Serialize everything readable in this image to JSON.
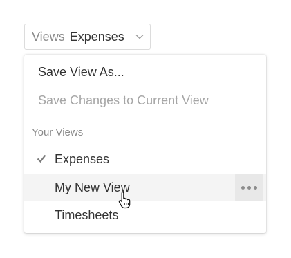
{
  "selector": {
    "prefix": "Views",
    "value": "Expenses",
    "chevron_icon": "chevron-down-icon"
  },
  "menu": {
    "actions": [
      {
        "label": "Save View As...",
        "enabled": true
      },
      {
        "label": "Save Changes to Current View",
        "enabled": false
      }
    ],
    "section_title": "Your Views",
    "views": [
      {
        "label": "Expenses",
        "selected": true,
        "hovered": false
      },
      {
        "label": "My New View",
        "selected": false,
        "hovered": true
      },
      {
        "label": "Timesheets",
        "selected": false,
        "hovered": false
      }
    ],
    "more_icon": "ellipsis-icon",
    "check_icon": "checkmark-icon"
  },
  "colors": {
    "text": "#333333",
    "muted": "#8a8a8a",
    "disabled": "#a6a6a6",
    "hover_bg": "#f4f4f4",
    "border": "#dcdcdc"
  }
}
